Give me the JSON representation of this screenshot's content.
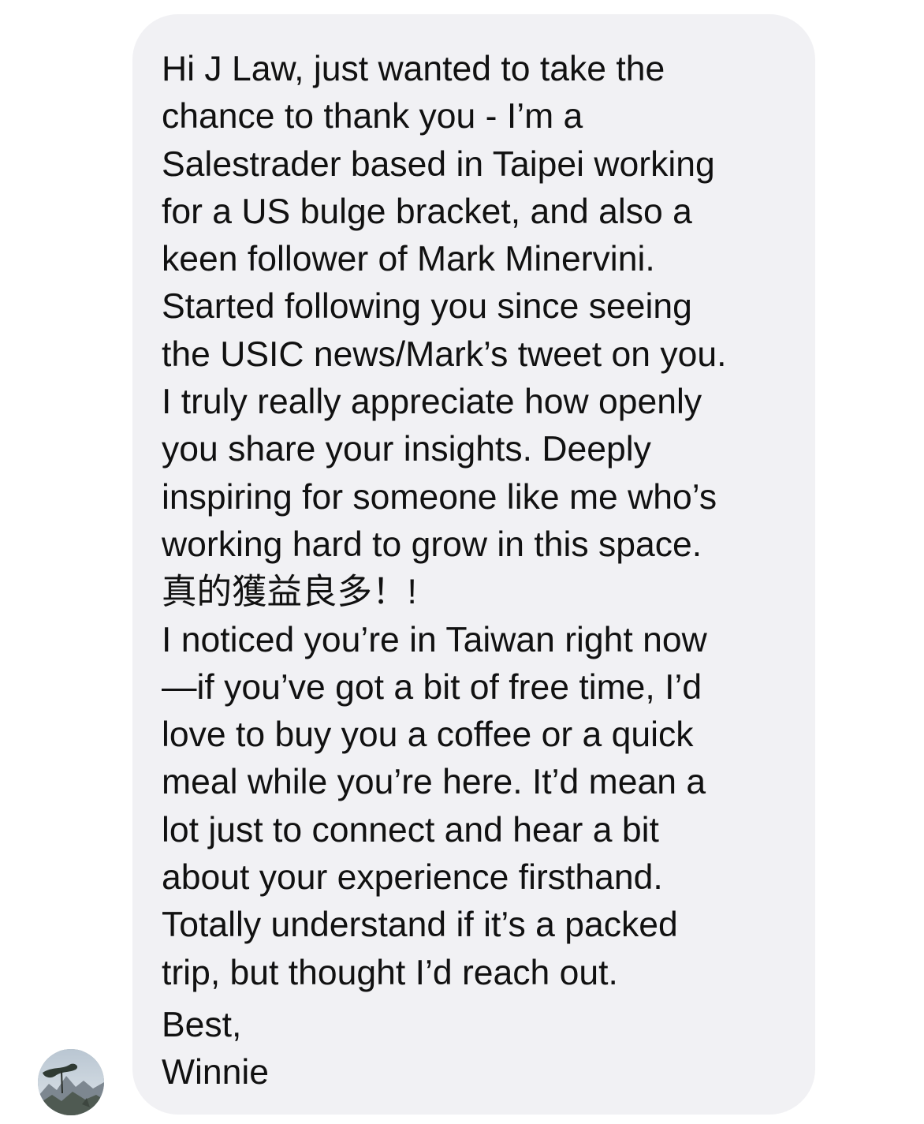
{
  "conversation": {
    "message": {
      "lines": [
        "Hi J Law, just wanted to take the",
        "chance to thank you - I’m a",
        "Salestrader based in Taipei working",
        "for a US bulge bracket, and also a",
        "keen follower of Mark Minervini.",
        "Started following you since seeing",
        "the USIC news/Mark’s tweet on you.",
        "I truly really appreciate how openly",
        "you share your insights. Deeply",
        "inspiring for someone like me who’s",
        "working hard to grow in this space.",
        "真的獲益良多！!",
        "I noticed you’re in Taiwan right now",
        "—if you’ve got a bit of free time, I’d",
        "love to buy you a coffee or a quick",
        "meal while you’re here. It’d mean a",
        "lot just to connect and hear a bit",
        "about your experience firsthand.",
        "Totally understand if it’s a packed",
        "trip, but thought I’d reach out."
      ],
      "closing": "Best,",
      "signature": "Winnie"
    },
    "sender": {
      "avatar_icon": "landscape-photo-avatar"
    },
    "colors": {
      "bubble_background": "#f1f1f4",
      "text": "#111111"
    }
  }
}
